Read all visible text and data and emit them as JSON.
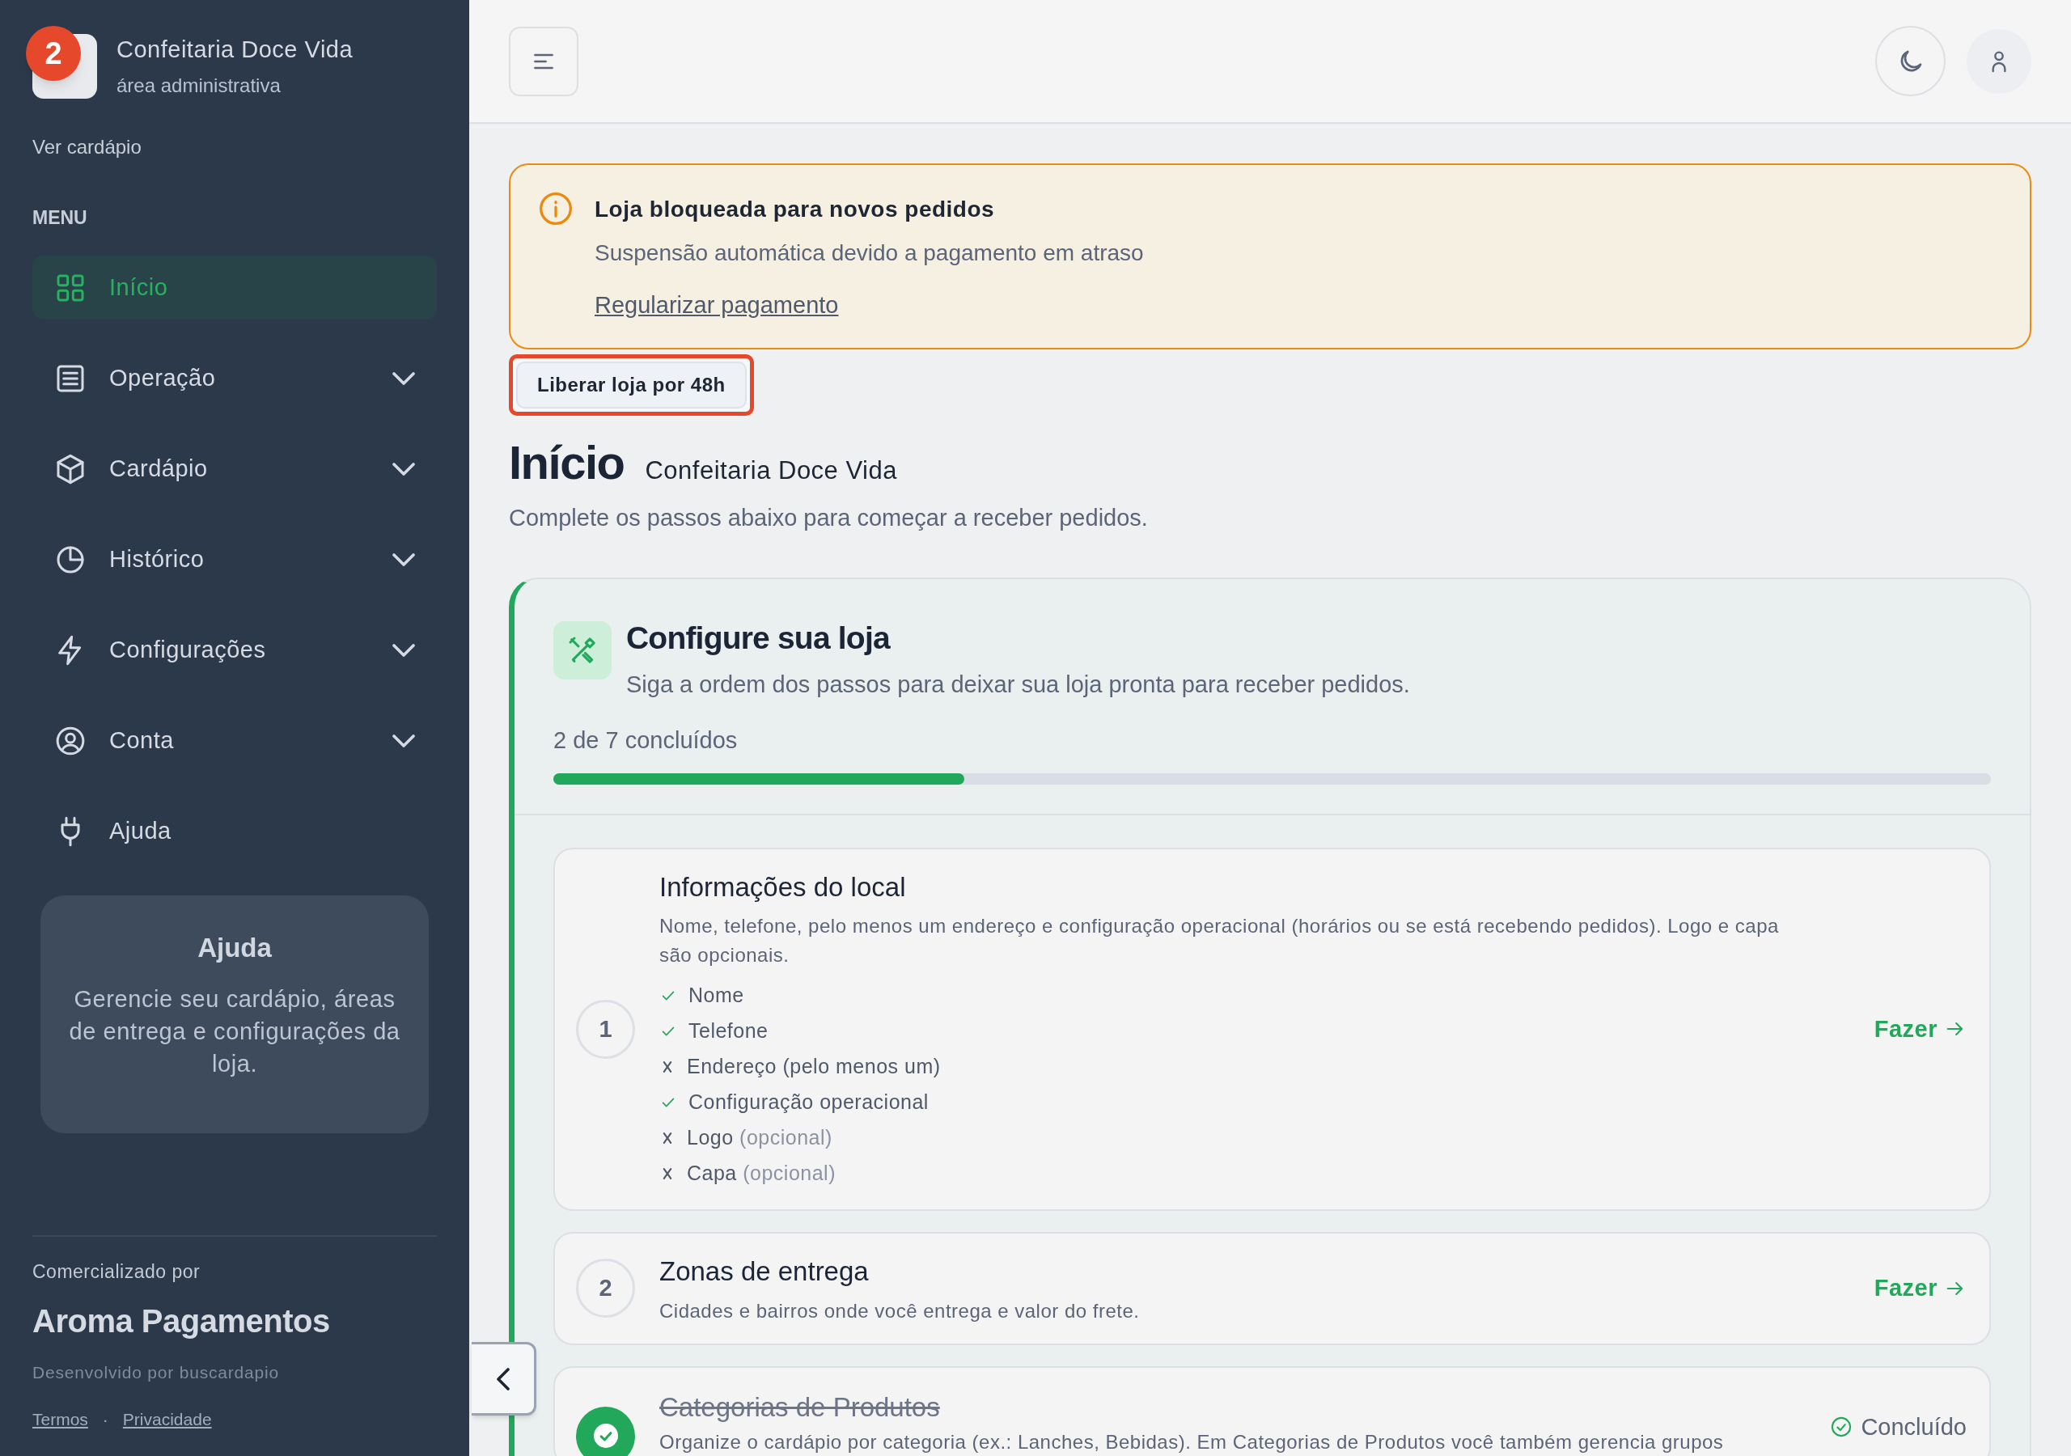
{
  "sidebar": {
    "badge": "2",
    "brand": {
      "name": "Confeitaria Doce Vida",
      "subtitle": "área administrativa"
    },
    "view_menu_link": "Ver cardápio",
    "menu_heading": "MENU",
    "items": [
      {
        "label": "Início",
        "selected": true,
        "expandable": false
      },
      {
        "label": "Operação",
        "selected": false,
        "expandable": true
      },
      {
        "label": "Cardápio",
        "selected": false,
        "expandable": true
      },
      {
        "label": "Histórico",
        "selected": false,
        "expandable": true
      },
      {
        "label": "Configurações",
        "selected": false,
        "expandable": true
      },
      {
        "label": "Conta",
        "selected": false,
        "expandable": true
      },
      {
        "label": "Ajuda",
        "selected": false,
        "expandable": false
      }
    ],
    "help_card": {
      "title": "Ajuda",
      "text": "Gerencie seu cardápio, áreas de entrega e configurações da loja."
    },
    "footer": {
      "marketed_by": "Comercializado por",
      "company": "Aroma Pagamentos",
      "developed_by": "Desenvolvido por buscardapio",
      "links": [
        "Termos",
        "Privacidade"
      ],
      "separator": "·"
    }
  },
  "alert": {
    "title": "Loja bloqueada para novos pedidos",
    "message": "Suspensão automática devido a pagamento em atraso",
    "link": "Regularizar pagamento"
  },
  "release_button": {
    "label": "Liberar loja por 48h",
    "highlighted": true
  },
  "page_header": {
    "title": "Início",
    "subtitle": "Confeitaria Doce Vida",
    "description": "Complete os passos abaixo para começar a receber pedidos."
  },
  "setup": {
    "title": "Configure sua loja",
    "subtitle": "Siga a ordem dos passos para deixar sua loja pronta para receber pedidos.",
    "progress_text": "2 de 7 concluídos",
    "level": 0.2857,
    "steps": [
      {
        "number": "1",
        "title": "Informações do local",
        "description": "Nome, telefone, pelo menos um endereço e configuração operacional (horários ou se está recebendo pedidos). Logo e capa são opcionais.",
        "done": false,
        "action": "Fazer",
        "checklist": [
          {
            "label": "Nome",
            "done": true
          },
          {
            "label": "Telefone",
            "done": true
          },
          {
            "label": "Endereço (pelo menos um)",
            "done": false
          },
          {
            "label": "Configuração operacional",
            "done": true
          },
          {
            "label": "Logo",
            "note": "(opcional)",
            "done": false
          },
          {
            "label": "Capa",
            "note": "(opcional)",
            "done": false
          }
        ]
      },
      {
        "number": "2",
        "title": "Zonas de entrega",
        "description": "Cidades e bairros onde você entrega e valor do frete.",
        "done": false,
        "action": "Fazer"
      },
      {
        "title": "Categorias de Produtos",
        "description": "Organize o cardápio por categoria (ex.: Lanches, Bebidas). Em Categorias de Produtos você também gerencia grupos",
        "done": true,
        "status": "Concluído"
      }
    ]
  }
}
